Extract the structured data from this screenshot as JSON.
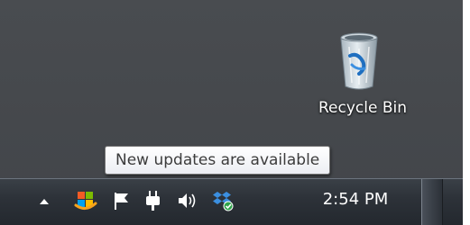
{
  "desktop": {
    "icons": [
      {
        "label": "Recycle Bin",
        "icon": "recycle-bin-icon"
      }
    ]
  },
  "tooltip": {
    "text": "New updates are available"
  },
  "taskbar": {
    "tray": {
      "overflow_icon": "chevron-up-icon",
      "icons": [
        "windows-update-icon",
        "action-center-flag-icon",
        "power-plug-icon",
        "speaker-volume-icon",
        "dropbox-sync-icon"
      ]
    },
    "clock": {
      "time": "2:54 PM"
    }
  }
}
